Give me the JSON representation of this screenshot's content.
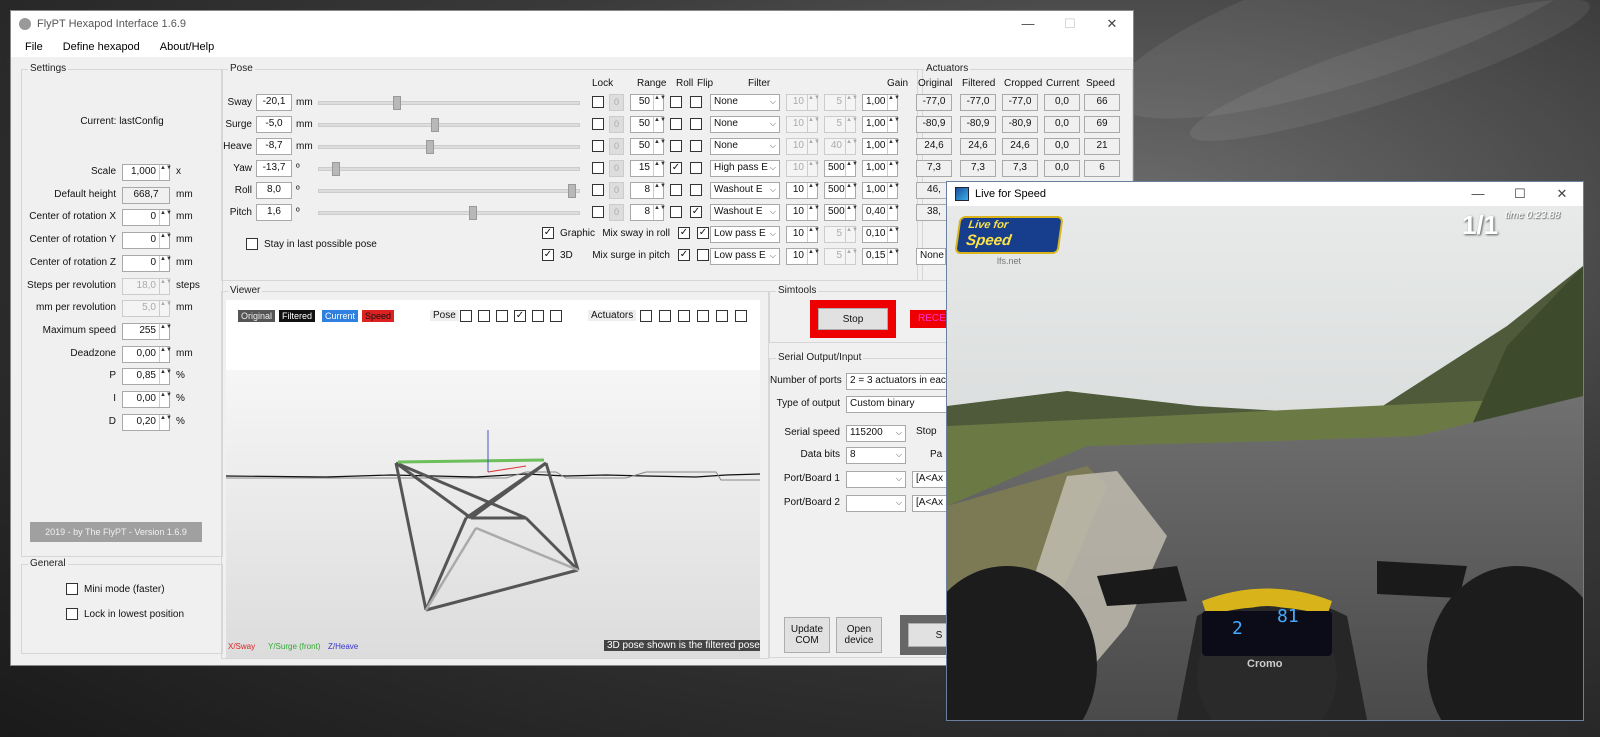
{
  "flypt": {
    "title": "FlyPT Hexapod Interface 1.6.9",
    "window_controls": {
      "minimize": "—",
      "maximize": "☐",
      "close": "✕"
    },
    "menu": [
      "File",
      "Define hexapod",
      "About/Help"
    ],
    "settings": {
      "title": "Settings",
      "current": "Current: lastConfig",
      "rows": [
        {
          "label": "Scale",
          "value": "1,000",
          "unit": "x",
          "type": "spin"
        },
        {
          "label": "Default height",
          "value": "668,7",
          "unit": "mm",
          "type": "ro"
        },
        {
          "label": "Center of rotation X",
          "value": "0",
          "unit": "mm",
          "type": "spin"
        },
        {
          "label": "Center of rotation Y",
          "value": "0",
          "unit": "mm",
          "type": "spin"
        },
        {
          "label": "Center of rotation Z",
          "value": "0",
          "unit": "mm",
          "type": "spin"
        },
        {
          "label": "Steps per revolution",
          "value": "18,0",
          "unit": "steps",
          "type": "spin-dis"
        },
        {
          "label": "mm per revolution",
          "value": "5,0",
          "unit": "mm",
          "type": "spin-dis"
        },
        {
          "label": "Maximum speed",
          "value": "255",
          "unit": "",
          "type": "spin"
        },
        {
          "label": "Deadzone",
          "value": "0,00",
          "unit": "mm",
          "type": "spin"
        },
        {
          "label": "P",
          "value": "0,85",
          "unit": "%",
          "type": "spin"
        },
        {
          "label": "I",
          "value": "0,00",
          "unit": "%",
          "type": "spin"
        },
        {
          "label": "D",
          "value": "0,20",
          "unit": "%",
          "type": "spin"
        }
      ],
      "footer": "2019 - by The FlyPT - Version 1.6.9"
    },
    "general": {
      "title": "General",
      "mini_mode": "Mini mode (faster)",
      "lock_lowest": "Lock in lowest position"
    },
    "pose": {
      "title": "Pose",
      "headers": {
        "lock": "Lock",
        "range": "Range",
        "roll": "Roll",
        "flip": "Flip",
        "filter": "Filter",
        "gain": "Gain"
      },
      "rows": [
        {
          "label": "Sway",
          "value": "-20,1",
          "unit": "mm",
          "slider": 0.29,
          "lock_val": "0",
          "range": "50",
          "roll": false,
          "flip": false,
          "filter": "None",
          "f1": "10",
          "f2": "5",
          "f1dis": true,
          "f2dis": true,
          "gain": "1,00"
        },
        {
          "label": "Surge",
          "value": "-5,0",
          "unit": "mm",
          "slider": 0.44,
          "lock_val": "0",
          "range": "50",
          "roll": false,
          "flip": false,
          "filter": "None",
          "f1": "10",
          "f2": "5",
          "f1dis": true,
          "f2dis": true,
          "gain": "1,00"
        },
        {
          "label": "Heave",
          "value": "-8,7",
          "unit": "mm",
          "slider": 0.42,
          "lock_val": "0",
          "range": "50",
          "roll": false,
          "flip": false,
          "filter": "None",
          "f1": "10",
          "f2": "40",
          "f1dis": true,
          "f2dis": true,
          "gain": "1,00"
        },
        {
          "label": "Yaw",
          "value": "-13,7",
          "unit": "º",
          "slider": 0.05,
          "lock_val": "0",
          "range": "15",
          "roll": true,
          "flip": false,
          "filter": "High pass E",
          "f1": "10",
          "f2": "500",
          "f1dis": true,
          "f2dis": false,
          "gain": "1,00"
        },
        {
          "label": "Roll",
          "value": "8,0",
          "unit": "º",
          "slider": 0.98,
          "lock_val": "0",
          "range": "8",
          "roll": false,
          "flip": false,
          "filter": "Washout E",
          "f1": "10",
          "f2": "500",
          "f1dis": false,
          "f2dis": false,
          "gain": "1,00"
        },
        {
          "label": "Pitch",
          "value": "1,6",
          "unit": "º",
          "slider": 0.59,
          "lock_val": "0",
          "range": "8",
          "roll": false,
          "flip": true,
          "filter": "Washout E",
          "f1": "10",
          "f2": "500",
          "f1dis": false,
          "f2dis": false,
          "gain": "0,40"
        }
      ],
      "stay_last": "Stay in last possible pose",
      "graphic": "Graphic",
      "three_d": "3D",
      "mix_sway": {
        "label": "Mix sway in roll",
        "filter": "Low pass E",
        "f1": "10",
        "f2": "5",
        "gain": "0,10"
      },
      "mix_surge": {
        "label": "Mix surge in pitch",
        "filter": "Low pass E",
        "f1": "10",
        "f2": "5",
        "gain": "0,15"
      }
    },
    "actuators": {
      "title": "Actuators",
      "headers": [
        "Original",
        "Filtered",
        "Cropped",
        "Current",
        "Speed"
      ],
      "rows": [
        [
          "-77,0",
          "-77,0",
          "-77,0",
          "0,0",
          "66"
        ],
        [
          "-80,9",
          "-80,9",
          "-80,9",
          "0,0",
          "69"
        ],
        [
          "24,6",
          "24,6",
          "24,6",
          "0,0",
          "21"
        ],
        [
          "7,3",
          "7,3",
          "7,3",
          "0,0",
          "6"
        ],
        [
          "46,",
          "",
          "",
          "",
          ""
        ],
        [
          "38,",
          "",
          "",
          "",
          ""
        ]
      ],
      "last_dd": "None"
    },
    "viewer": {
      "title": "Viewer",
      "legend": {
        "original": "Original",
        "filtered": "Filtered",
        "current": "Current",
        "speed": "Speed"
      },
      "pose_label": "Pose",
      "pose_checks": [
        false,
        false,
        false,
        true,
        false,
        false
      ],
      "actuators_label": "Actuators",
      "actuator_checks": [
        false,
        false,
        false,
        false,
        false,
        false
      ],
      "axis_x": "X/Sway",
      "axis_y": "Y/Surge (front)",
      "axis_z": "Z/Heave",
      "note": "3D pose shown is the filtered pose!"
    },
    "simtools": {
      "title": "Simtools",
      "stop": "Stop",
      "receiving": "RECE"
    },
    "serial": {
      "title": "Serial Output/Input",
      "number_of_ports_label": "Number of ports",
      "number_of_ports": "2 = 3 actuators in eac",
      "type_label": "Type of output",
      "type": "Custom binary",
      "speed_label": "Serial speed",
      "speed": "115200",
      "stop_label": "Stop",
      "bits_label": "Data bits",
      "bits": "8",
      "pa_label": "Pa",
      "port1_label": "Port/Board 1",
      "port1_fmt": "[A<Ax",
      "port2_label": "Port/Board 2",
      "port2_fmt": "[A<Ax",
      "update_com": "Update COM",
      "open_device": "Open device",
      "s_button": "S"
    }
  },
  "lfs": {
    "title": "Live for Speed",
    "window_controls": {
      "minimize": "—",
      "maximize": "☐",
      "close": "✕"
    },
    "hud_lap": "1/1",
    "hud_time": "time 0:23.88",
    "logo_line1": "Live for",
    "logo_line2": "Speed",
    "logo_site": "lfs.net",
    "steering_brand": "Cromo",
    "dash_gear": "2",
    "dash_speed": "81"
  }
}
